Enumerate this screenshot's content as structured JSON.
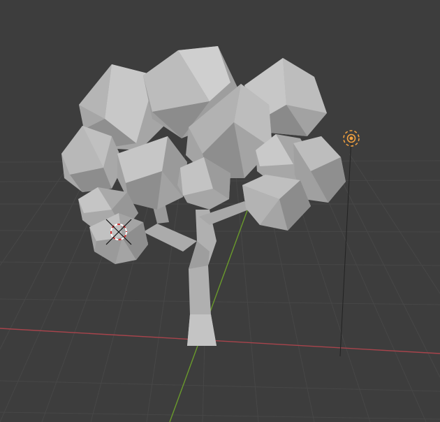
{
  "viewport": {
    "background": "#3d3d3d",
    "grid_color": "#4a4a4a",
    "x_axis_color": "#a8444c",
    "y_axis_color": "#6a9a2c"
  },
  "scene": {
    "objects": [
      {
        "name": "tree",
        "type": "mesh",
        "color": "#bdbdbd"
      },
      {
        "name": "light",
        "type": "point-light",
        "icon": "light-icon",
        "color": "#f0a040"
      },
      {
        "name": "3d-cursor",
        "type": "cursor",
        "icon": "3d-cursor-icon"
      }
    ]
  }
}
